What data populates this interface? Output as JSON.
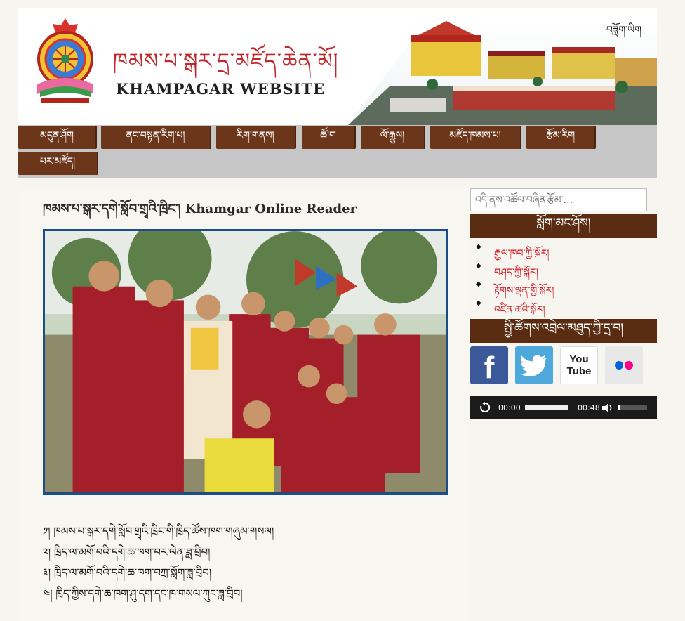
{
  "header": {
    "title_tibetan": "ཁམས་པ་སྒར་དྲ་མཛོད་ཆེན་མོ།",
    "title_english": "KHAMPAGAR WEBSITE",
    "language_link": "བཟློག་ཡིག"
  },
  "nav": {
    "items": [
      {
        "label": "མདུན་ཤོག"
      },
      {
        "label": "ནང་བསྟན་རིག་པ།"
      },
      {
        "label": "རིག་གནས།"
      },
      {
        "label": "ཚོ་ག"
      },
      {
        "label": "ལོ་རྒྱུས།"
      },
      {
        "label": "མཛོད་ཁམས་པ།"
      },
      {
        "label": "རྩོམ་རིག"
      },
      {
        "label": "པར་མཛོད།"
      }
    ]
  },
  "main": {
    "page_title": "ཁམས་པ་སྒར་དགེ་སློབ་གྲྭའི་ཁྲིང་། Khamgar Online Reader",
    "list_items": [
      "༡། ཁམས་པ་སྒར་དགེ་སློབ་གྲྭའི་ཁྲིང་གི་ཁྲིད་ཚོས་ཁག་གཞུམ་གསལ།",
      "༢། ཁྲིད་ལ་མགོ་བའི་དགེ་ཆ་ཁག་བར་ལེན་ཟླ་བྲིབ།",
      "༣། ཁྲིད་ལ་མགོ་བའི་དགེ་ཆ་ཁག་བཀྲ་སློག་ཟླ་བྲིབ།",
      "༤། ཁྲིད་ཀྱིས་དགེ་ཆ་ཁག་ཤུ་དག་དང་ཁ་གསལ་ཀུང་ཟླ་བྲིབ།"
    ]
  },
  "sidebar": {
    "search_placeholder": "འདི་ནས་འཚོལ་བཞིན་རྩོམ་…",
    "widget_links_title": "སློག་མང་ཤོས།",
    "links": [
      {
        "label": "རྒྱལ་ཁབ་ཀྱི་སྐོར།"
      },
      {
        "label": "བཤད་ཀྱི་སྐོར།"
      },
      {
        "label": "རྟོགས་ལྡན་གྱི་སྐོར།"
      },
      {
        "label": "འཛིན་ཚའི་སྐོར།"
      }
    ],
    "widget_social_title": "སྤྱི་ཚོགས་འབྲེལ་མཐུད་ཀྱི་དྲ་བ།",
    "social": [
      {
        "name": "facebook",
        "label": "f",
        "color": "#3b5998"
      },
      {
        "name": "twitter",
        "label": "",
        "color": "#4fa8dc"
      },
      {
        "name": "youtube",
        "label": "You Tube",
        "color": "#e52d27"
      },
      {
        "name": "flickr",
        "label": "",
        "color": "#e8e8e8"
      }
    ],
    "audio": {
      "current_time": "00:00",
      "duration": "00:48",
      "progress": 0.0,
      "volume": 0.1
    }
  }
}
